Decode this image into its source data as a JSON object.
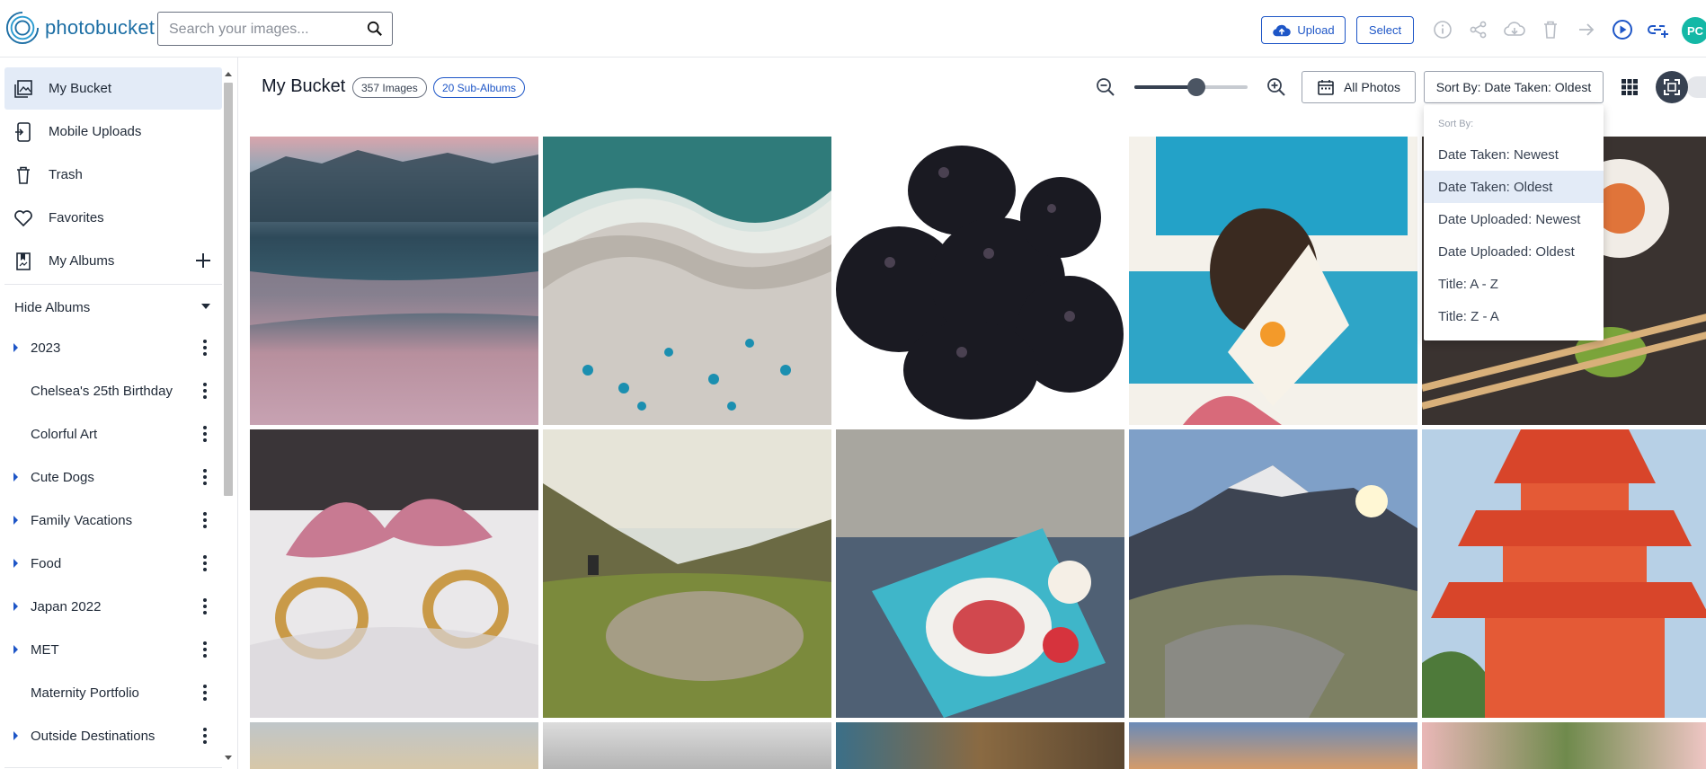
{
  "header": {
    "logo_text": "photobucket",
    "search_placeholder": "Search your images...",
    "upload_label": "Upload",
    "select_label": "Select",
    "avatar_initials": "PC"
  },
  "sidebar": {
    "nav": [
      {
        "label": "My Bucket",
        "icon": "image-stack-icon",
        "active": true
      },
      {
        "label": "Mobile Uploads",
        "icon": "phone-upload-icon"
      },
      {
        "label": "Trash",
        "icon": "trash-icon"
      },
      {
        "label": "Favorites",
        "icon": "heart-icon"
      },
      {
        "label": "My Albums",
        "icon": "album-icon"
      }
    ],
    "hide_albums_label": "Hide Albums",
    "albums": [
      {
        "name": "2023",
        "expandable": true
      },
      {
        "name": "Chelsea's 25th Birthday",
        "expandable": false
      },
      {
        "name": "Colorful Art",
        "expandable": false
      },
      {
        "name": "Cute Dogs",
        "expandable": true
      },
      {
        "name": "Family Vacations",
        "expandable": true
      },
      {
        "name": "Food",
        "expandable": true
      },
      {
        "name": "Japan 2022",
        "expandable": true
      },
      {
        "name": "MET",
        "expandable": true
      },
      {
        "name": "Maternity Portfolio",
        "expandable": false
      },
      {
        "name": "Outside Destinations",
        "expandable": true
      }
    ]
  },
  "main": {
    "title": "My Bucket",
    "image_count": "357 Images",
    "sub_albums": "20 Sub-Albums",
    "zoom_level": 0.55,
    "all_photos_label": "All Photos",
    "sort_label": "Sort By: Date Taken: Oldest",
    "photos": [
      {
        "subject": "mountain lake at dusk"
      },
      {
        "subject": "aerial beach"
      },
      {
        "subject": "blackberries"
      },
      {
        "subject": "colorful art"
      },
      {
        "subject": "sushi"
      },
      {
        "subject": "wedding rings"
      },
      {
        "subject": "green valley"
      },
      {
        "subject": "breakfast tray"
      },
      {
        "subject": "mountain sunrise"
      },
      {
        "subject": "red pagoda"
      }
    ]
  },
  "sort_dropdown": {
    "header": "Sort By:",
    "options": [
      "Date Taken: Newest",
      "Date Taken: Oldest",
      "Date Uploaded: Newest",
      "Date Uploaded: Oldest",
      "Title: A - Z",
      "Title: Z - A"
    ],
    "selected_index": 1
  },
  "colors": {
    "brand": "#1d6fa5",
    "accent": "#1e56c7",
    "active_bg": "#e3ebf7",
    "avatar": "#14b8a6"
  }
}
